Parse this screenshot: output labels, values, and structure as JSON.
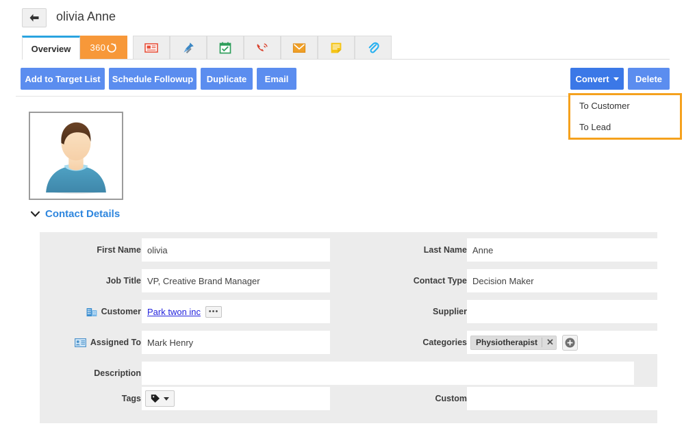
{
  "header": {
    "back_icon": "back-arrow-icon",
    "record_title": "olivia Anne"
  },
  "tabs": [
    {
      "label": "Overview",
      "icon": "",
      "active": true
    },
    {
      "label": "360",
      "icon": "360-refresh-icon",
      "active": false
    },
    {
      "label": "",
      "icon": "news-list-icon",
      "active": false
    },
    {
      "label": "",
      "icon": "pushpin-icon",
      "active": false
    },
    {
      "label": "",
      "icon": "calendar-check-icon",
      "active": false
    },
    {
      "label": "",
      "icon": "phone-call-icon",
      "active": false
    },
    {
      "label": "",
      "icon": "envelope-icon",
      "active": false
    },
    {
      "label": "",
      "icon": "note-icon",
      "active": false
    },
    {
      "label": "",
      "icon": "paperclip-icon",
      "active": false
    }
  ],
  "actions": {
    "add_to_target_list": "Add to Target List",
    "schedule_followup": "Schedule Followup",
    "duplicate": "Duplicate",
    "email": "Email",
    "convert": "Convert",
    "delete": "Delete"
  },
  "convert_menu": {
    "items": [
      "To Customer",
      "To Lead"
    ],
    "highlight_color": "#f5a11d"
  },
  "section": {
    "contact_details_title": "Contact Details",
    "chevron_icon": "chevron-down-icon"
  },
  "avatar": {
    "icon": "user-avatar-photo"
  },
  "form": {
    "first_name": {
      "label": "First Name",
      "value": "olivia"
    },
    "last_name": {
      "label": "Last Name",
      "value": "Anne"
    },
    "job_title": {
      "label": "Job Title",
      "value": "VP, Creative Brand Manager"
    },
    "contact_type": {
      "label": "Contact Type",
      "value": "Decision Maker"
    },
    "customer": {
      "label": "Customer",
      "value": "Park twon inc",
      "more_button": "•••",
      "icon": "building-icon"
    },
    "supplier": {
      "label": "Supplier",
      "value": ""
    },
    "assigned_to": {
      "label": "Assigned To",
      "value": "Mark Henry",
      "icon": "contact-card-icon"
    },
    "categories": {
      "label": "Categories",
      "chip": "Physiotherapist",
      "remove": "✕",
      "add_button": "+"
    },
    "description": {
      "label": "Description",
      "value": ""
    },
    "tags": {
      "label": "Tags",
      "value": "",
      "button_icon": "tag-icon"
    },
    "custom": {
      "label": "Custom",
      "value": ""
    }
  },
  "colors": {
    "accent_blue": "#5b8def",
    "active_tab_blue": "#29a3e0",
    "tab360_orange": "#f79839",
    "link_blue": "#2e86de",
    "panel_gray": "#ececec"
  }
}
